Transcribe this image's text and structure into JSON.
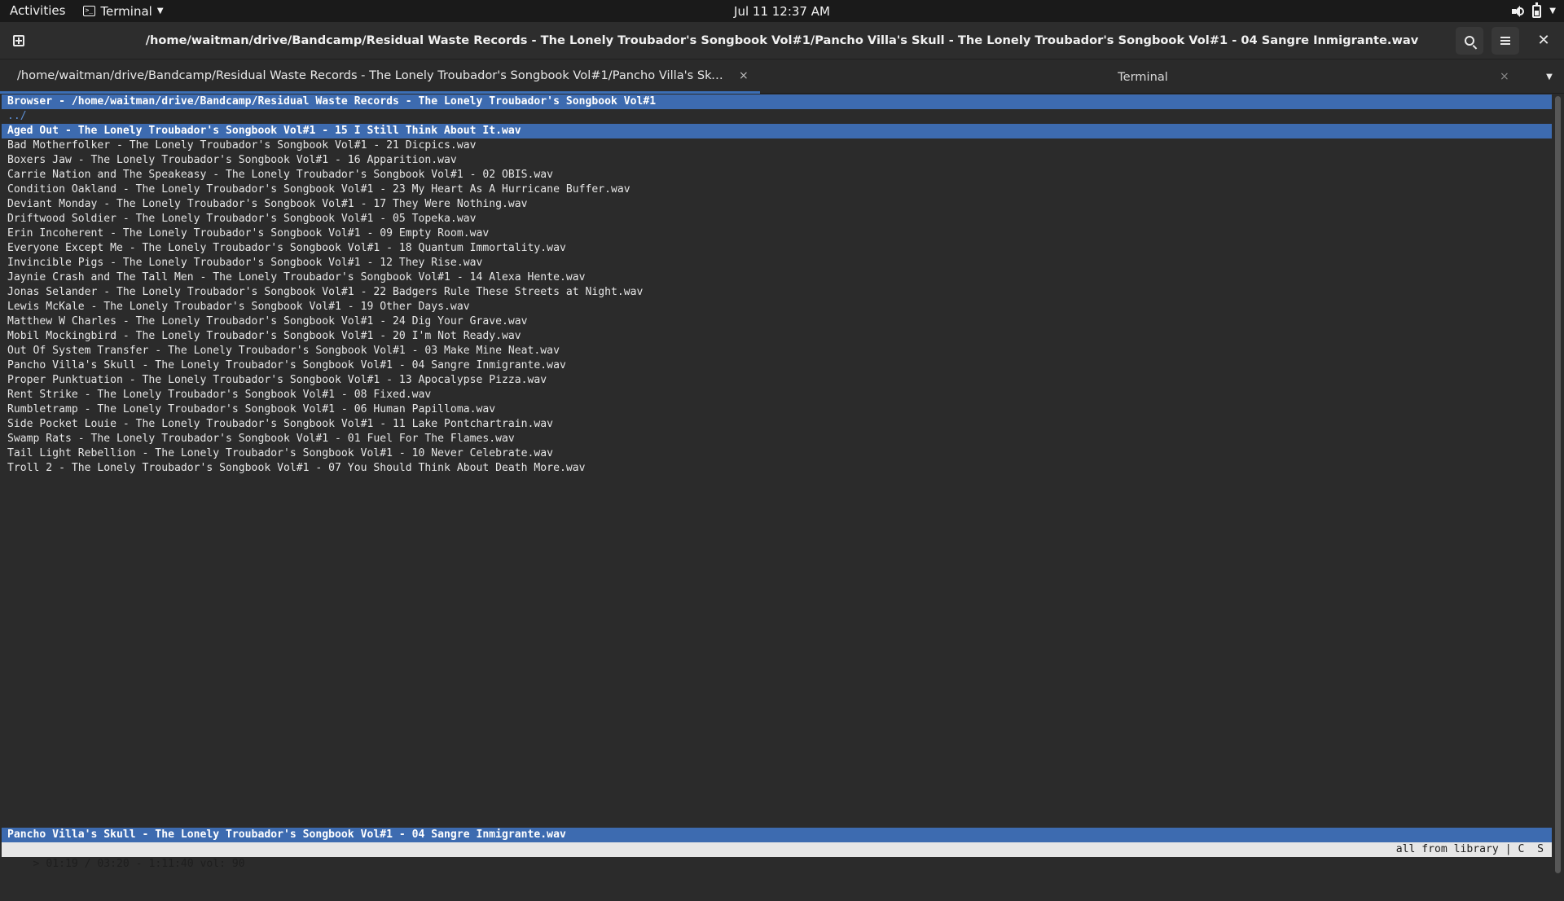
{
  "topbar": {
    "activities": "Activities",
    "app_name": "Terminal",
    "clock": "Jul 11  12:37 AM"
  },
  "headerbar": {
    "title": "/home/waitman/drive/Bandcamp/Residual Waste Records - The Lonely Troubador's Songbook Vol#1/Pancho Villa's Skull - The Lonely Troubador's Songbook Vol#1 - 04 Sangre Inmigrante.wav"
  },
  "tabs": [
    {
      "label": "/home/waitman/drive/Bandcamp/Residual Waste Records - The Lonely Troubador's Songbook Vol#1/Pancho Villa's Skull - The Lonely Troubador's Songbook Vol#1 - 04 Sangre Inmigrante.wav",
      "close": "×"
    },
    {
      "label": "Terminal",
      "close": "×"
    }
  ],
  "cmus": {
    "browser_header": "Browser - /home/waitman/drive/Bandcamp/Residual Waste Records - The Lonely Troubador's Songbook Vol#1",
    "parent_dir": "../",
    "files": [
      "Aged Out - The Lonely Troubador's Songbook Vol#1 - 15 I Still Think About It.wav",
      "Bad Motherfolker - The Lonely Troubador's Songbook Vol#1 - 21 Dicpics.wav",
      "Boxers Jaw - The Lonely Troubador's Songbook Vol#1 - 16 Apparition.wav",
      "Carrie Nation and The Speakeasy - The Lonely Troubador's Songbook Vol#1 - 02 OBIS.wav",
      "Condition Oakland - The Lonely Troubador's Songbook Vol#1 - 23 My Heart As A Hurricane Buffer.wav",
      "Deviant Monday - The Lonely Troubador's Songbook Vol#1 - 17 They Were Nothing.wav",
      "Driftwood Soldier - The Lonely Troubador's Songbook Vol#1 - 05 Topeka.wav",
      "Erin Incoherent - The Lonely Troubador's Songbook Vol#1 - 09 Empty Room.wav",
      "Everyone Except Me - The Lonely Troubador's Songbook Vol#1 - 18 Quantum Immortality.wav",
      "Invincible Pigs - The Lonely Troubador's Songbook Vol#1 - 12 They Rise.wav",
      "Jaynie Crash and The Tall Men - The Lonely Troubador's Songbook Vol#1 - 14 Alexa Hente.wav",
      "Jonas Selander - The Lonely Troubador's Songbook Vol#1 - 22 Badgers Rule These Streets at Night.wav",
      "Lewis McKale - The Lonely Troubador's Songbook Vol#1 - 19 Other Days.wav",
      "Matthew W Charles - The Lonely Troubador's Songbook Vol#1 - 24 Dig Your Grave.wav",
      "Mobil Mockingbird - The Lonely Troubador's Songbook Vol#1 - 20 I'm Not Ready.wav",
      "Out Of System Transfer - The Lonely Troubador's Songbook Vol#1 - 03 Make Mine Neat.wav",
      "Pancho Villa's Skull - The Lonely Troubador's Songbook Vol#1 - 04 Sangre Inmigrante.wav",
      "Proper Punktuation - The Lonely Troubador's Songbook Vol#1 - 13 Apocalypse Pizza.wav",
      "Rent Strike - The Lonely Troubador's Songbook Vol#1 - 08 Fixed.wav",
      "Rumbletramp - The Lonely Troubador's Songbook Vol#1 - 06 Human Papilloma.wav",
      "Side Pocket Louie - The Lonely Troubador's Songbook Vol#1 - 11 Lake Pontchartrain.wav",
      "Swamp Rats - The Lonely Troubador's Songbook Vol#1 - 01 Fuel For The Flames.wav",
      "Tail Light Rebellion - The Lonely Troubador's Songbook Vol#1 - 10 Never Celebrate.wav",
      "Troll 2 - The Lonely Troubador's Songbook Vol#1 - 07 You Should Think About Death More.wav"
    ],
    "now_playing": "Pancho Villa's Skull - The Lonely Troubador's Songbook Vol#1 - 04 Sangre Inmigrante.wav",
    "status_left": "> 01:19 / 03:20 - 1:11:40 vol: 90",
    "status_right": "all from library | C  S"
  },
  "colors": {
    "highlight": "#3d6bb0",
    "parent_dir": "#5d8fd6",
    "tab_indicator": "#3b6fb6"
  },
  "icons": [
    "terminal-icon",
    "speaker-icon",
    "battery-icon",
    "new-tab-icon",
    "search-icon",
    "hamburger-menu-icon",
    "close-icon"
  ]
}
